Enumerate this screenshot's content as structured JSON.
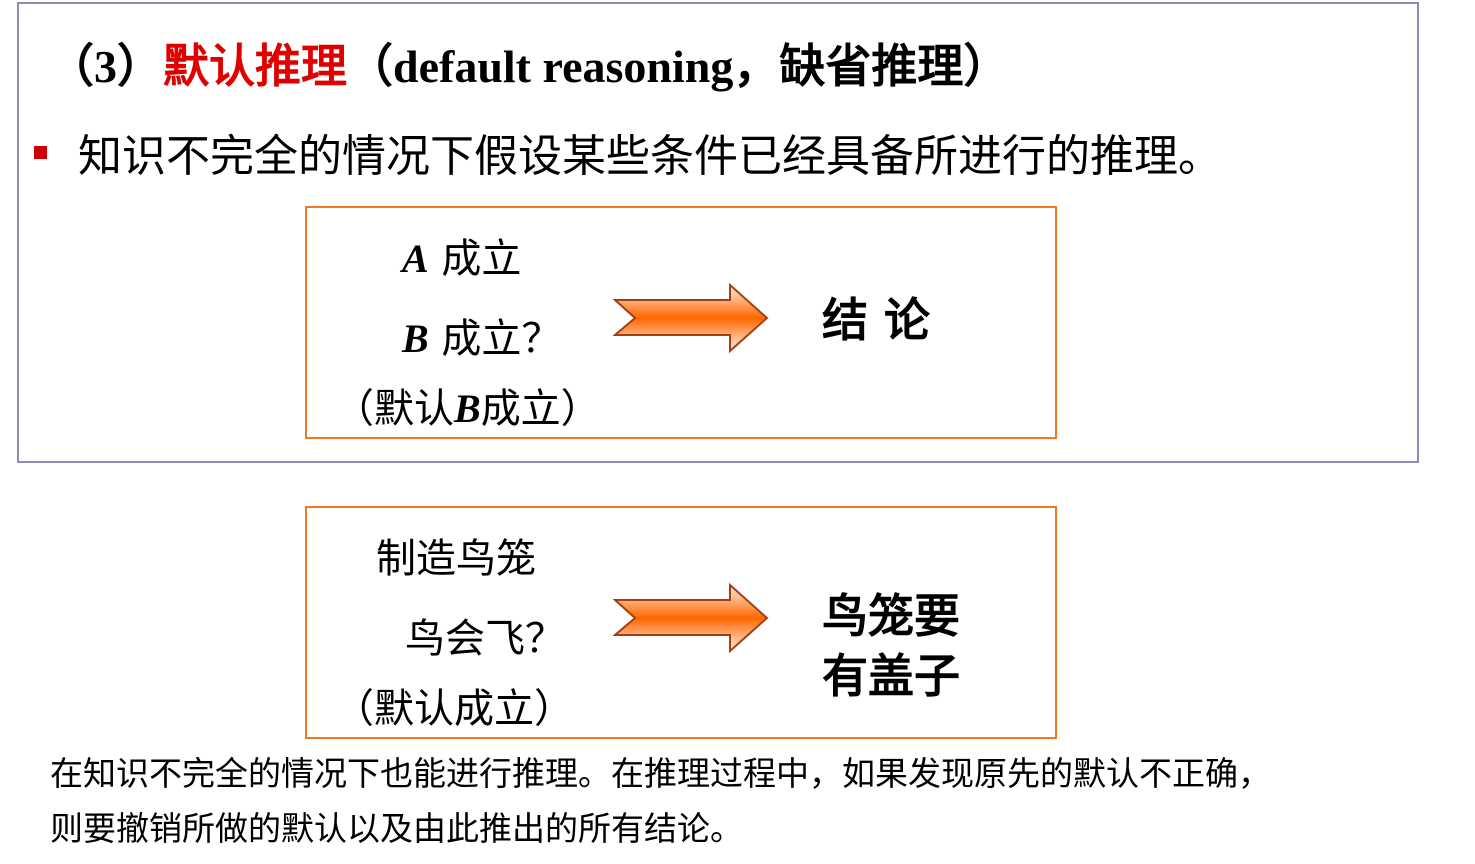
{
  "title": {
    "prefix": "（3）",
    "term": "默认推理",
    "suffix": "（default reasoning，缺省推理）"
  },
  "bullet": "知识不完全的情况下假设某些条件已经具备所进行的推理。",
  "example1": {
    "line1_var": "A",
    "line1": " 成立",
    "line2_var": "B",
    "line2": " 成立？",
    "line3_a": "（默认",
    "line3_var": "B",
    "line3_b": "成立）",
    "conclusion": "结 论"
  },
  "example2": {
    "line1": "制造鸟笼",
    "line2": "鸟会飞？",
    "line3": "（默认成立）",
    "conclusion_1": "鸟笼要",
    "conclusion_2": "有盖子"
  },
  "note": [
    "在知识不完全的情况下也能进行推理。在推理过程中，如果发现原先的默认不正确，",
    "则要撤销所做的默认以及由此推出的所有结论。"
  ],
  "colors": {
    "accent": "#e00000",
    "box_border": "#f07820",
    "arrow": "#ff6600",
    "frame": "#8c8cb4"
  }
}
